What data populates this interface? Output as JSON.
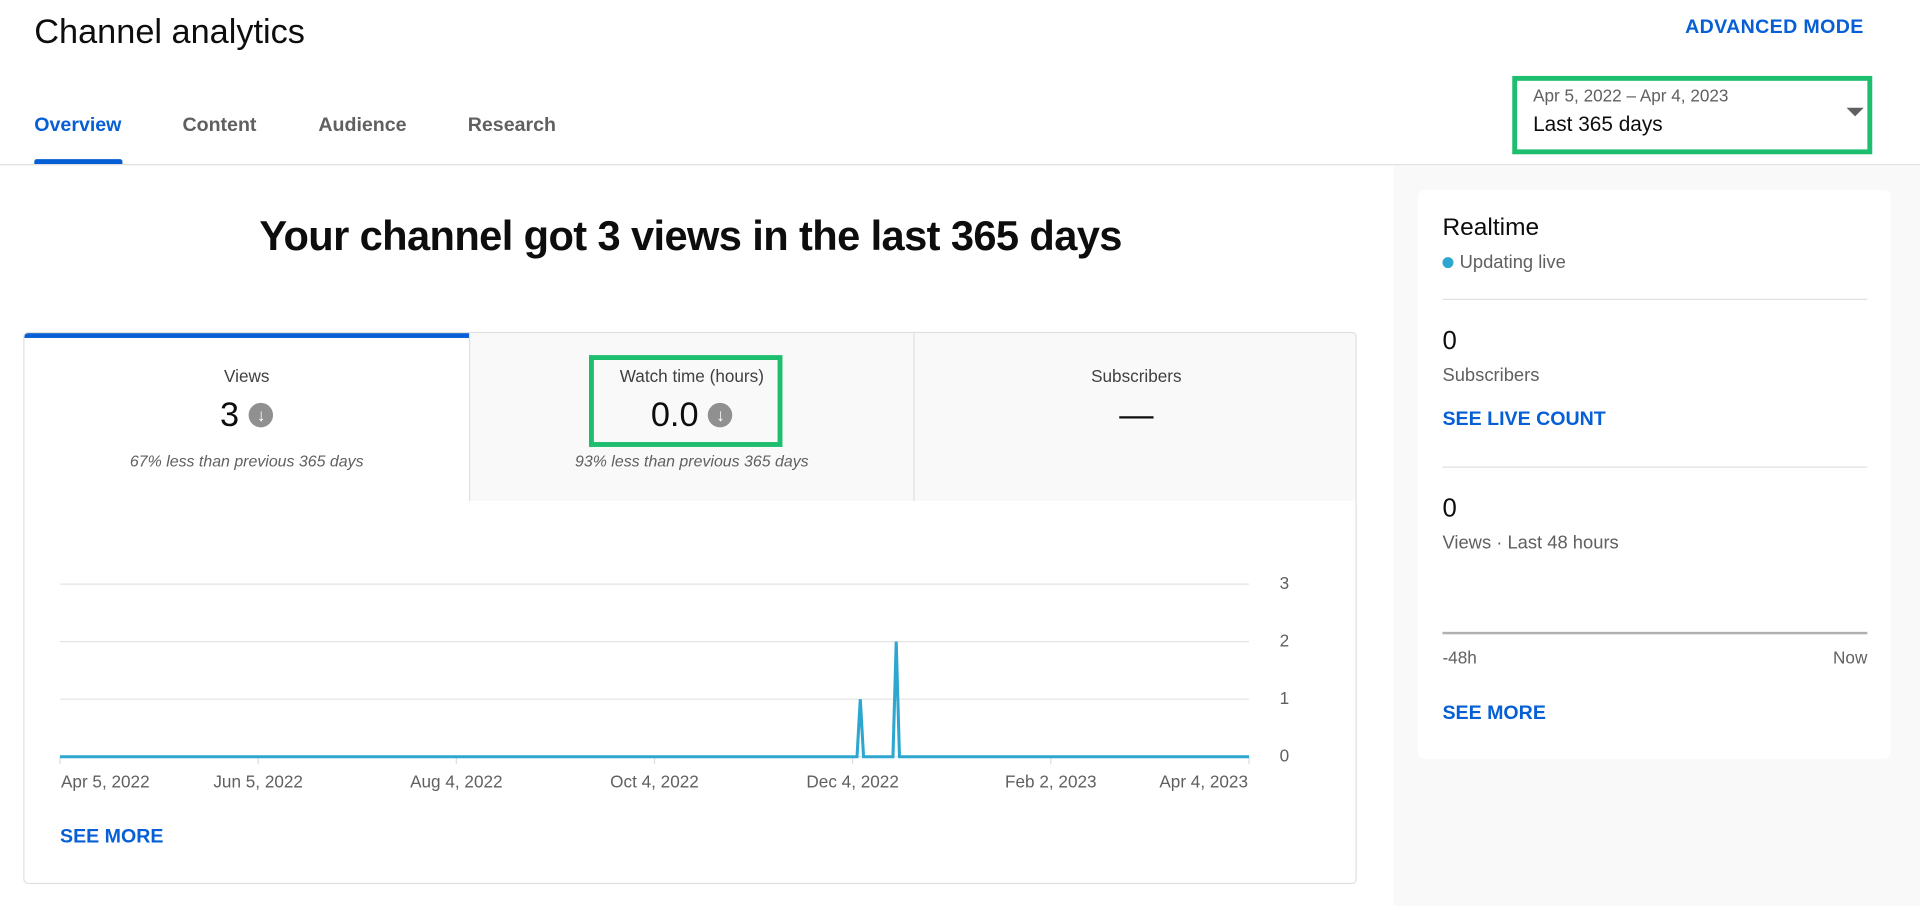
{
  "header": {
    "title": "Channel analytics",
    "advanced_mode": "ADVANCED MODE",
    "tabs": [
      {
        "label": "Overview",
        "active": true
      },
      {
        "label": "Content"
      },
      {
        "label": "Audience"
      },
      {
        "label": "Research"
      }
    ],
    "date_picker": {
      "range": "Apr 5, 2022 – Apr 4, 2023",
      "selected": "Last 365 days"
    }
  },
  "main": {
    "headline": "Your channel got 3 views in the last 365 days",
    "metrics": [
      {
        "label": "Views",
        "value": "3",
        "trend": "down",
        "comparison": "67% less than previous 365 days"
      },
      {
        "label": "Watch time (hours)",
        "value": "0.0",
        "trend": "down",
        "comparison": "93% less than previous 365 days"
      },
      {
        "label": "Subscribers",
        "value": "—",
        "comparison": ""
      }
    ],
    "see_more": "SEE MORE"
  },
  "chart_data": {
    "type": "line",
    "series_color": "#2ea7d0",
    "ylim": [
      0,
      3
    ],
    "y_ticks": [
      "0",
      "1",
      "2",
      "3"
    ],
    "x_ticks": [
      "Apr 5, 2022",
      "Jun 5, 2022",
      "Aug 4, 2022",
      "Oct 4, 2022",
      "Dec 4, 2022",
      "Feb 2, 2023",
      "Apr 4, 2023"
    ],
    "x_range": [
      "2022-04-05",
      "2023-04-04"
    ],
    "points": [
      {
        "x": "2022-12-06",
        "y": 1
      },
      {
        "x": "2022-12-17",
        "y": 2
      }
    ],
    "baseline": 0
  },
  "realtime": {
    "title": "Realtime",
    "status": "Updating live",
    "status_color": "#2ea7d0",
    "subscribers_value": "0",
    "subscribers_label": "Subscribers",
    "see_live_count": "SEE LIVE COUNT",
    "views_value": "0",
    "views_label": "Views · Last 48 hours",
    "axis_start": "-48h",
    "axis_end": "Now",
    "see_more": "SEE MORE"
  },
  "colors": {
    "accent": "#065fd4",
    "highlight": "#1dbe6e"
  }
}
